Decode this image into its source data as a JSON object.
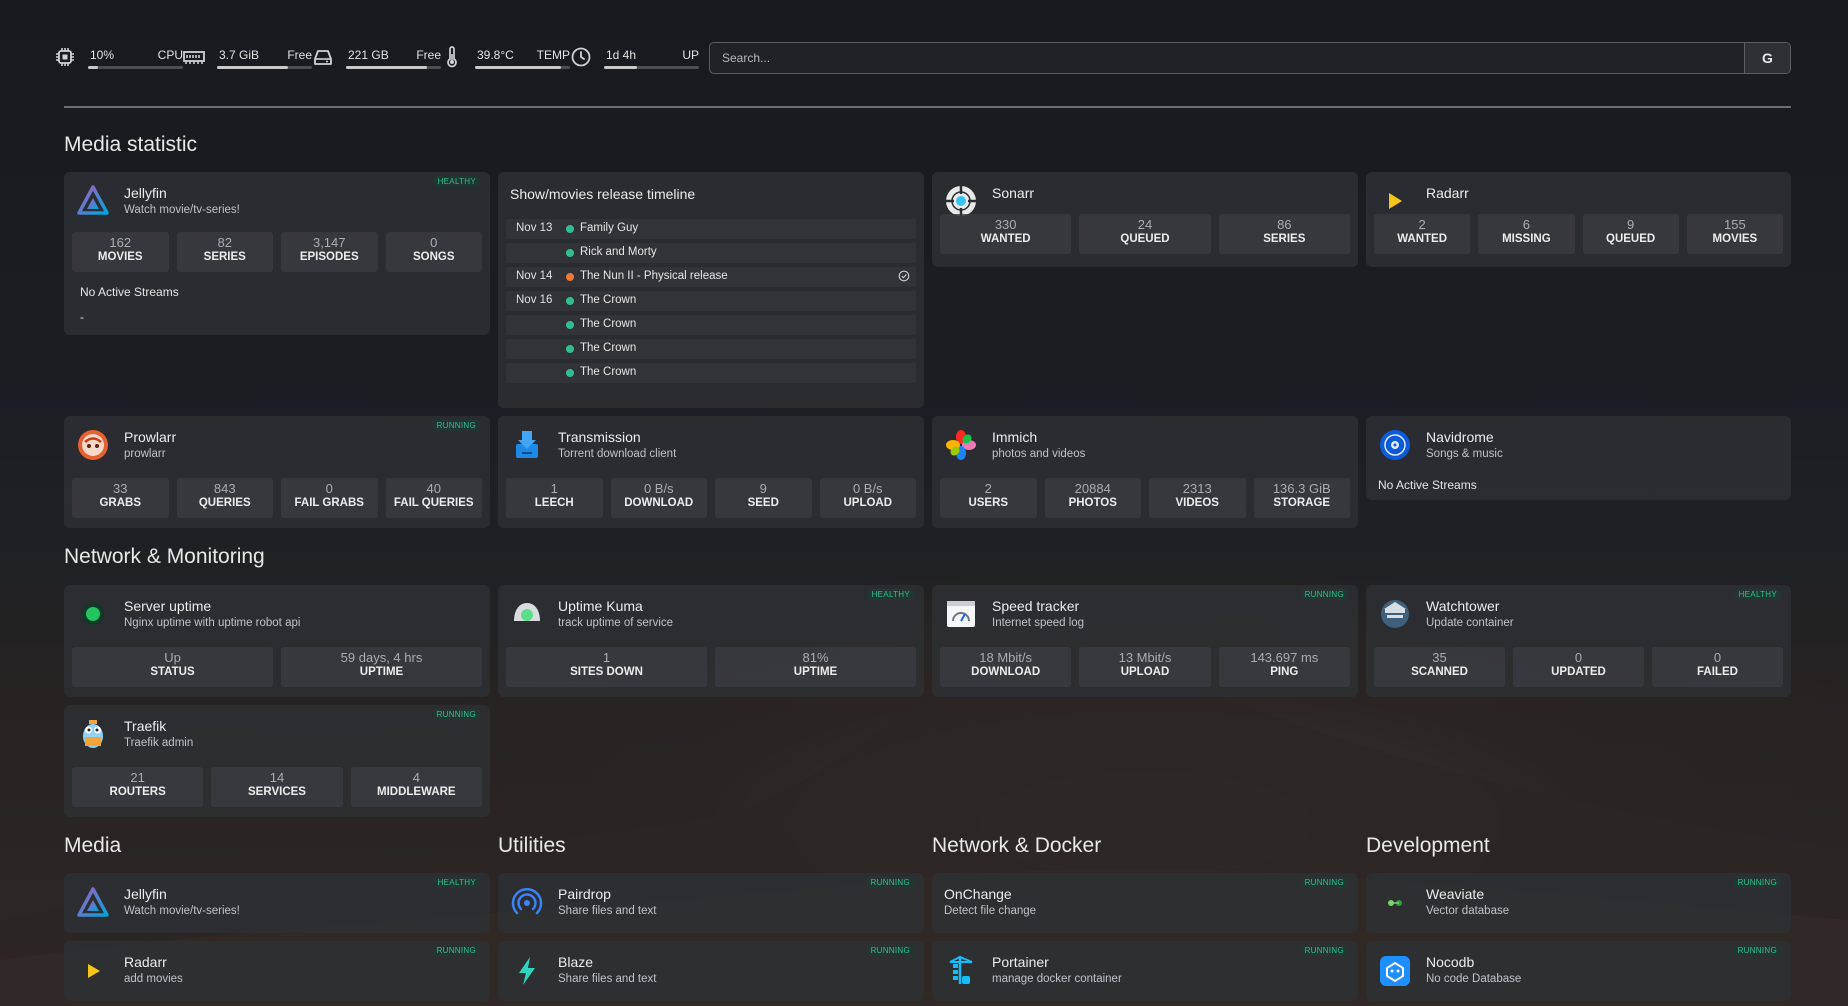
{
  "topbar": {
    "metrics": [
      {
        "icon": "cpu-icon",
        "value": "10%",
        "label": "CPU",
        "level": 0.1
      },
      {
        "icon": "ram-icon",
        "value": "3.7 GiB",
        "label": "Free",
        "level": 0.75
      },
      {
        "icon": "disk-icon",
        "value": "221 GB",
        "label": "Free",
        "level": 0.85
      },
      {
        "icon": "thermometer-icon",
        "value": "39.8°C",
        "label": "TEMP",
        "level": 0.9
      },
      {
        "icon": "clock-icon",
        "value": "1d 4h",
        "label": "UP",
        "level": 0.35
      }
    ],
    "search_placeholder": "Search...",
    "search_button": "G"
  },
  "sections": {
    "media_statistic": "Media statistic",
    "network_monitoring": "Network & Monitoring",
    "media": "Media",
    "utilities": "Utilities",
    "network_docker": "Network & Docker",
    "development": "Development"
  },
  "jellyfin": {
    "name": "Jellyfin",
    "desc": "Watch movie/tv-series!",
    "badge": "HEALTHY",
    "stats": [
      {
        "n": "162",
        "l": "MOVIES"
      },
      {
        "n": "82",
        "l": "SERIES"
      },
      {
        "n": "3,147",
        "l": "EPISODES"
      },
      {
        "n": "0",
        "l": "SONGS"
      }
    ],
    "streams": "No Active Streams",
    "dash": "-"
  },
  "timeline": {
    "title": "Show/movies release timeline",
    "rows": [
      {
        "date": "Nov 13",
        "title": "Family Guy",
        "color": "#2fbf8f"
      },
      {
        "date": "",
        "title": "Rick and Morty",
        "color": "#2fbf8f"
      },
      {
        "date": "Nov 14",
        "title": "The Nun II - Physical release",
        "color": "#ee7a35"
      },
      {
        "date": "Nov 16",
        "title": "The Crown",
        "color": "#2fbf8f"
      },
      {
        "date": "",
        "title": "The Crown",
        "color": "#2fbf8f"
      },
      {
        "date": "",
        "title": "The Crown",
        "color": "#2fbf8f"
      },
      {
        "date": "",
        "title": "The Crown",
        "color": "#2fbf8f"
      }
    ]
  },
  "sonarr": {
    "name": "Sonarr",
    "stats": [
      {
        "n": "330",
        "l": "WANTED"
      },
      {
        "n": "24",
        "l": "QUEUED"
      },
      {
        "n": "86",
        "l": "SERIES"
      }
    ]
  },
  "radarr_stat": {
    "name": "Radarr",
    "stats": [
      {
        "n": "2",
        "l": "WANTED"
      },
      {
        "n": "6",
        "l": "MISSING"
      },
      {
        "n": "9",
        "l": "QUEUED"
      },
      {
        "n": "155",
        "l": "MOVIES"
      }
    ]
  },
  "prowlarr": {
    "name": "Prowlarr",
    "desc": "prowlarr",
    "badge": "RUNNING",
    "stats": [
      {
        "n": "33",
        "l": "GRABS"
      },
      {
        "n": "843",
        "l": "QUERIES"
      },
      {
        "n": "0",
        "l": "FAIL GRABS"
      },
      {
        "n": "40",
        "l": "FAIL QUERIES"
      }
    ]
  },
  "transmission": {
    "name": "Transmission",
    "desc": "Torrent download client",
    "stats": [
      {
        "n": "1",
        "l": "LEECH"
      },
      {
        "n": "0 B/s",
        "l": "DOWNLOAD"
      },
      {
        "n": "9",
        "l": "SEED"
      },
      {
        "n": "0 B/s",
        "l": "UPLOAD"
      }
    ]
  },
  "immich": {
    "name": "Immich",
    "desc": "photos and videos",
    "stats": [
      {
        "n": "2",
        "l": "USERS"
      },
      {
        "n": "20884",
        "l": "PHOTOS"
      },
      {
        "n": "2313",
        "l": "VIDEOS"
      },
      {
        "n": "136.3 GiB",
        "l": "STORAGE"
      }
    ]
  },
  "navidrome": {
    "name": "Navidrome",
    "desc": "Songs & music",
    "streams": "No Active Streams"
  },
  "server_uptime": {
    "name": "Server uptime",
    "desc": "Nginx uptime with uptime robot api",
    "stats": [
      {
        "n": "Up",
        "l": "STATUS"
      },
      {
        "n": "59 days, 4 hrs",
        "l": "UPTIME"
      }
    ]
  },
  "uptime_kuma": {
    "name": "Uptime Kuma",
    "desc": "track uptime of service",
    "badge": "HEALTHY",
    "stats": [
      {
        "n": "1",
        "l": "SITES DOWN"
      },
      {
        "n": "81%",
        "l": "UPTIME"
      }
    ]
  },
  "speed_tracker": {
    "name": "Speed tracker",
    "desc": "Internet speed log",
    "badge": "RUNNING",
    "stats": [
      {
        "n": "18 Mbit/s",
        "l": "DOWNLOAD"
      },
      {
        "n": "13 Mbit/s",
        "l": "UPLOAD"
      },
      {
        "n": "143.697 ms",
        "l": "PING"
      }
    ]
  },
  "watchtower": {
    "name": "Watchtower",
    "desc": "Update container",
    "badge": "HEALTHY",
    "stats": [
      {
        "n": "35",
        "l": "SCANNED"
      },
      {
        "n": "0",
        "l": "UPDATED"
      },
      {
        "n": "0",
        "l": "FAILED"
      }
    ]
  },
  "traefik": {
    "name": "Traefik",
    "desc": "Traefik admin",
    "badge": "RUNNING",
    "stats": [
      {
        "n": "21",
        "l": "ROUTERS"
      },
      {
        "n": "14",
        "l": "SERVICES"
      },
      {
        "n": "4",
        "l": "MIDDLEWARE"
      }
    ]
  },
  "apps": {
    "jellyfin": {
      "name": "Jellyfin",
      "desc": "Watch movie/tv-series!",
      "badge": "HEALTHY"
    },
    "radarr": {
      "name": "Radarr",
      "desc": "add movies",
      "badge": "RUNNING"
    },
    "pairdrop": {
      "name": "Pairdrop",
      "desc": "Share files and text",
      "badge": "RUNNING"
    },
    "blaze": {
      "name": "Blaze",
      "desc": "Share files and text",
      "badge": "RUNNING"
    },
    "onchange": {
      "name": "OnChange",
      "desc": "Detect file change",
      "badge": "RUNNING"
    },
    "portainer": {
      "name": "Portainer",
      "desc": "manage docker container",
      "badge": "RUNNING"
    },
    "weaviate": {
      "name": "Weaviate",
      "desc": "Vector database",
      "badge": "RUNNING"
    },
    "nocodb": {
      "name": "Nocodb",
      "desc": "No code Database",
      "badge": "RUNNING"
    }
  }
}
